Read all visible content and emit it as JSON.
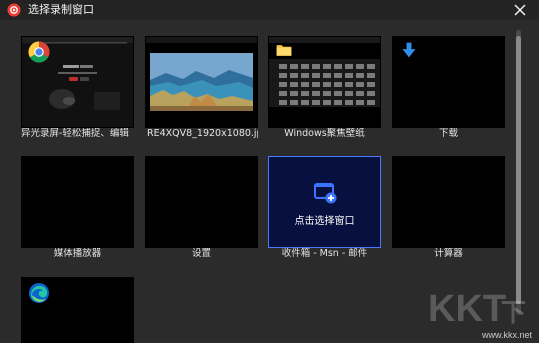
{
  "window": {
    "title": "选择录制窗口"
  },
  "windows": [
    {
      "title": "异光录屏-轻松捕捉、编辑",
      "icon": "chrome-icon",
      "selected": false
    },
    {
      "title": "RE4XQV8_1920x1080.jpg - 照",
      "icon": "landscape-thumbnail",
      "selected": false
    },
    {
      "title": "Windows聚焦壁纸",
      "icon": "folder-icon",
      "selected": false
    },
    {
      "title": "下载",
      "icon": "download-arrow-icon",
      "selected": false
    },
    {
      "title": "媒体播放器",
      "icon": "",
      "selected": false
    },
    {
      "title": "设置",
      "icon": "",
      "selected": false
    },
    {
      "title": "收件箱 - Msn - 邮件",
      "icon": "",
      "selected": true,
      "hover_label": "点击选择窗口"
    },
    {
      "title": "计算器",
      "icon": "",
      "selected": false
    },
    {
      "title": "",
      "icon": "edge-icon",
      "selected": false
    }
  ],
  "watermark": {
    "text": "KKT下载",
    "url": "www.kkx.net"
  },
  "colors": {
    "accent": "#4a7bff",
    "background": "#2b2b2c",
    "app_red": "#ef3d36"
  }
}
